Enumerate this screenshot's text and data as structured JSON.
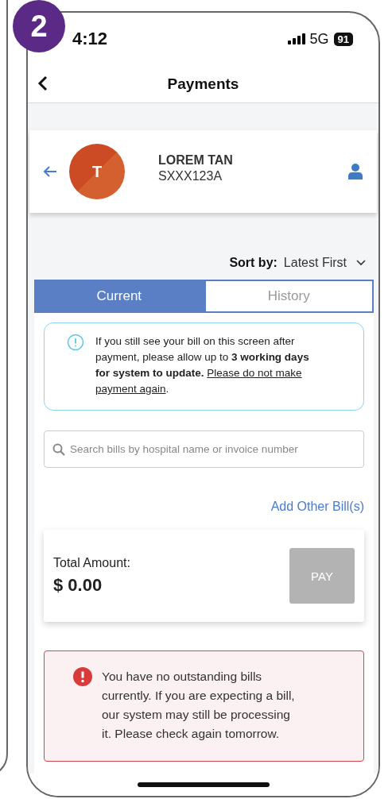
{
  "step_badge": "2",
  "status_bar": {
    "time": "4:12",
    "network": "5G",
    "battery": "91"
  },
  "nav": {
    "title": "Payments"
  },
  "profile": {
    "initial": "T",
    "name": "LOREM TAN",
    "id": "SXXX123A"
  },
  "sort": {
    "label": "Sort by:",
    "value": "Latest First"
  },
  "tabs": [
    {
      "label": "Current",
      "selected": true
    },
    {
      "label": "History",
      "selected": false
    }
  ],
  "notice": {
    "text": "If you still see your bill on this screen after payment, please allow up to **3 working days for system to update.**",
    "emphasis": "Please do not make payment again",
    "end": "."
  },
  "search": {
    "placeholder": "Search bills by hospital name or invoice number"
  },
  "add_bill": "Add Other Bill(s)",
  "total": {
    "label": "Total Amount:",
    "amount": "$ 0.00"
  },
  "pay_button": {
    "label": "PAY",
    "disabled": true
  },
  "empty_notice": "You have no outstanding bills currently. If you are expecting a bill, our system may still be processing it. Please check again tomorrow."
}
